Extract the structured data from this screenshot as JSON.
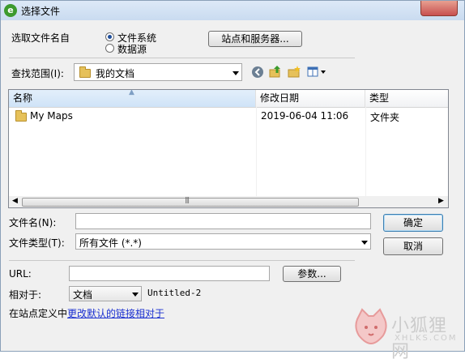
{
  "window": {
    "title": "选择文件"
  },
  "select_from": {
    "label": "选取文件名自",
    "options": [
      {
        "label": "文件系统",
        "selected": true
      },
      {
        "label": "数据源",
        "selected": false
      }
    ],
    "sites_button": "站点和服务器..."
  },
  "lookin": {
    "label": "查找范围(I):",
    "value": "我的文档"
  },
  "toolbar": {
    "icons": [
      "back-icon",
      "up-folder-icon",
      "new-folder-icon",
      "view-menu-icon"
    ]
  },
  "filelist": {
    "columns": [
      "名称",
      "修改日期",
      "类型"
    ],
    "rows": [
      {
        "name": "My Maps",
        "modified": "2019-06-04 11:06",
        "type": "文件夹"
      }
    ]
  },
  "filename": {
    "label": "文件名(N):",
    "value": ""
  },
  "filetype": {
    "label": "文件类型(T):",
    "value": "所有文件 (*.*)"
  },
  "buttons": {
    "ok": "确定",
    "cancel": "取消",
    "params": "参数..."
  },
  "url": {
    "label": "URL:",
    "value": ""
  },
  "relative": {
    "label": "相对于:",
    "value": "文档",
    "doc_name": "Untitled-2"
  },
  "footer": {
    "prefix": "在站点定义中",
    "link": "更改默认的链接相对于"
  },
  "watermark": {
    "text": "小狐狸网",
    "subtext": "XHLKS.COM"
  },
  "colors": {
    "accent": "#1a2fd0",
    "title_bar": "#c9dbf0",
    "close": "#c75050"
  }
}
